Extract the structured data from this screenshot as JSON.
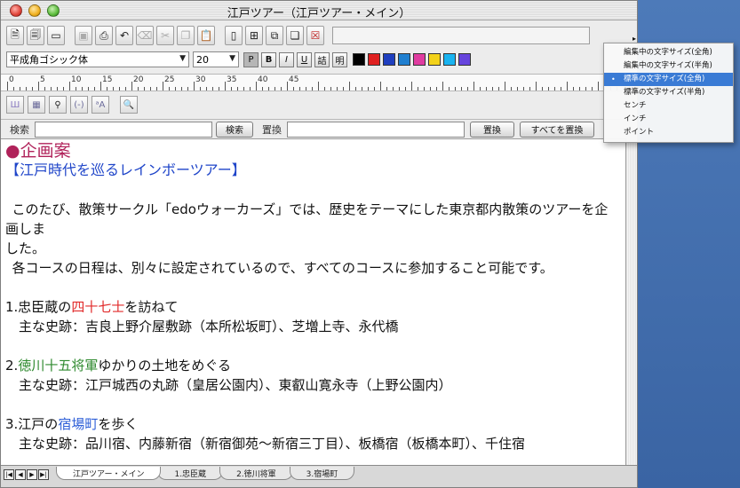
{
  "window": {
    "title": "江戸ツアー（江戸ツアー・メイン）"
  },
  "format_bar": {
    "font_name": "平成角ゴシック体",
    "font_size": "20",
    "plain_label": "P",
    "bold_label": "B",
    "italic_label": "I",
    "underline_label": "U",
    "vertical_label": "詰",
    "mincho_label": "明",
    "colors": [
      "#000000",
      "#e02020",
      "#1f3fbf",
      "#1f7fd0",
      "#e03ca0",
      "#f3d21a",
      "#19b3f0",
      "#6644dd"
    ]
  },
  "ruler": {
    "marks": [
      "0",
      "5",
      "10",
      "15",
      "20",
      "25",
      "30",
      "35",
      "40",
      "45"
    ]
  },
  "search_bar": {
    "search_label": "検索",
    "search_value": "",
    "search_button": "検索",
    "replace_label": "置換",
    "replace_value": "",
    "replace_button": "置換",
    "replace_all_button": "すべてを置換"
  },
  "document": {
    "heading": "●企画案",
    "subheading": "【江戸時代を巡るレインボーツアー】",
    "intro_line1": "このたび、散策サークル「edoウォーカーズ」では、歴史をテーマにした東京都内散策のツアーを企画しま",
    "intro_line2": "した。",
    "intro_line3": "各コースの日程は、別々に設定されているので、すべてのコースに参加すること可能です。",
    "item1_prefix": "1.忠臣蔵の",
    "item1_highlight": "四十七士",
    "item1_suffix": "を訪ねて",
    "item1_sites": "主な史跡：吉良上野介屋敷跡（本所松坂町）、芝増上寺、永代橋",
    "item2_prefix": "2.",
    "item2_highlight": "徳川十五将軍",
    "item2_suffix": "ゆかりの土地をめぐる",
    "item2_sites": "主な史跡：江戸城西の丸跡（皇居公園内）、東叡山寛永寺（上野公園内）",
    "item3_prefix": "3.江戸の",
    "item3_highlight": "宿場町",
    "item3_suffix": "を歩く",
    "item3_sites": "主な史跡：品川宿、内藤新宿（新宿御苑～新宿三丁目）、板橋宿（板橋本町）、千住宿"
  },
  "tabs": [
    {
      "label": "江戸ツアー・メイン",
      "active": true
    },
    {
      "label": "1.忠臣蔵",
      "active": false
    },
    {
      "label": "2.徳川将軍",
      "active": false
    },
    {
      "label": "3.宿場町",
      "active": false
    }
  ],
  "popup_menu": {
    "items": [
      {
        "label": "編集中の文字サイズ(全角)",
        "selected": false
      },
      {
        "label": "編集中の文字サイズ(半角)",
        "selected": false
      },
      {
        "label": "標準の文字サイズ(全角)",
        "selected": true
      },
      {
        "label": "標準の文字サイズ(半角)",
        "selected": false
      },
      {
        "label": "センチ",
        "selected": false
      },
      {
        "label": "インチ",
        "selected": false
      },
      {
        "label": "ポイント",
        "selected": false
      }
    ],
    "check_glyph": "•"
  }
}
